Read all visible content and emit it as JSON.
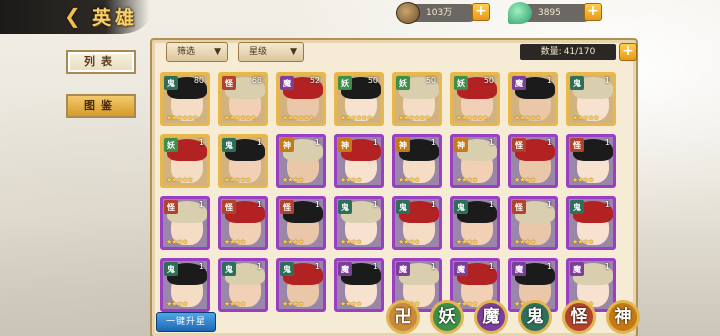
{
  "header": {
    "title": "英雄",
    "resources": [
      {
        "name": "coin",
        "value": "103万"
      },
      {
        "name": "jade",
        "value": "3895"
      }
    ]
  },
  "left_tabs": [
    {
      "label": "列表"
    },
    {
      "label": "图鉴"
    }
  ],
  "toolbar": {
    "filter_label": "筛选",
    "star_label": "星级",
    "count_label": "数量:",
    "count_value": "41/170"
  },
  "heroes": [
    {
      "faction": "鬼",
      "level": "80",
      "stars": 6,
      "frame": "gold"
    },
    {
      "faction": "怪",
      "level": "68",
      "stars": 6,
      "frame": "gold"
    },
    {
      "faction": "魔",
      "level": "52",
      "stars": 6,
      "frame": "gold"
    },
    {
      "faction": "妖",
      "level": "50",
      "stars": 6,
      "frame": "gold"
    },
    {
      "faction": "妖",
      "level": "50",
      "stars": 6,
      "frame": "gold"
    },
    {
      "faction": "妖",
      "level": "50",
      "stars": 6,
      "frame": "gold"
    },
    {
      "faction": "魔",
      "level": "1",
      "stars": 5,
      "frame": "gold"
    },
    {
      "faction": "鬼",
      "level": "1",
      "stars": 5,
      "frame": "gold"
    },
    {
      "faction": "妖",
      "level": "1",
      "stars": 5,
      "frame": "gold"
    },
    {
      "faction": "鬼",
      "level": "1",
      "stars": 5,
      "frame": "gold"
    },
    {
      "faction": "神",
      "level": "1",
      "stars": 4,
      "frame": "purple"
    },
    {
      "faction": "神",
      "level": "1",
      "stars": 4,
      "frame": "purple"
    },
    {
      "faction": "神",
      "level": "1",
      "stars": 4,
      "frame": "purple"
    },
    {
      "faction": "神",
      "level": "1",
      "stars": 4,
      "frame": "purple"
    },
    {
      "faction": "怪",
      "level": "1",
      "stars": 4,
      "frame": "purple"
    },
    {
      "faction": "怪",
      "level": "1",
      "stars": 4,
      "frame": "purple"
    },
    {
      "faction": "怪",
      "level": "1",
      "stars": 4,
      "frame": "purple"
    },
    {
      "faction": "怪",
      "level": "1",
      "stars": 4,
      "frame": "purple"
    },
    {
      "faction": "怪",
      "level": "1",
      "stars": 4,
      "frame": "purple"
    },
    {
      "faction": "鬼",
      "level": "1",
      "stars": 4,
      "frame": "purple"
    },
    {
      "faction": "鬼",
      "level": "1",
      "stars": 4,
      "frame": "purple"
    },
    {
      "faction": "鬼",
      "level": "1",
      "stars": 4,
      "frame": "purple"
    },
    {
      "faction": "怪",
      "level": "1",
      "stars": 4,
      "frame": "purple"
    },
    {
      "faction": "鬼",
      "level": "1",
      "stars": 4,
      "frame": "purple"
    },
    {
      "faction": "鬼",
      "level": "1",
      "stars": 4,
      "frame": "purple"
    },
    {
      "faction": "鬼",
      "level": "1",
      "stars": 4,
      "frame": "purple"
    },
    {
      "faction": "鬼",
      "level": "1",
      "stars": 4,
      "frame": "purple"
    },
    {
      "faction": "魔",
      "level": "1",
      "stars": 4,
      "frame": "purple"
    },
    {
      "faction": "魔",
      "level": "1",
      "stars": 4,
      "frame": "purple"
    },
    {
      "faction": "魔",
      "level": "1",
      "stars": 4,
      "frame": "purple"
    },
    {
      "faction": "魔",
      "level": "1",
      "stars": 4,
      "frame": "purple"
    },
    {
      "faction": "魔",
      "level": "1",
      "stars": 4,
      "frame": "purple"
    }
  ],
  "bottom": {
    "upgrade_label": "一键升星",
    "faction_filters": [
      {
        "label": "卍",
        "color": "#c98a3a"
      },
      {
        "label": "妖",
        "color": "#3f8f4a"
      },
      {
        "label": "魔",
        "color": "#7b3f9a"
      },
      {
        "label": "鬼",
        "color": "#2f6f5a"
      },
      {
        "label": "怪",
        "color": "#b0432c"
      },
      {
        "label": "神",
        "color": "#c47a16"
      }
    ]
  },
  "colors": {
    "gold_frame": "#e8b94a",
    "purple_frame": "#9a3fc4",
    "accent": "#f5d26a"
  }
}
